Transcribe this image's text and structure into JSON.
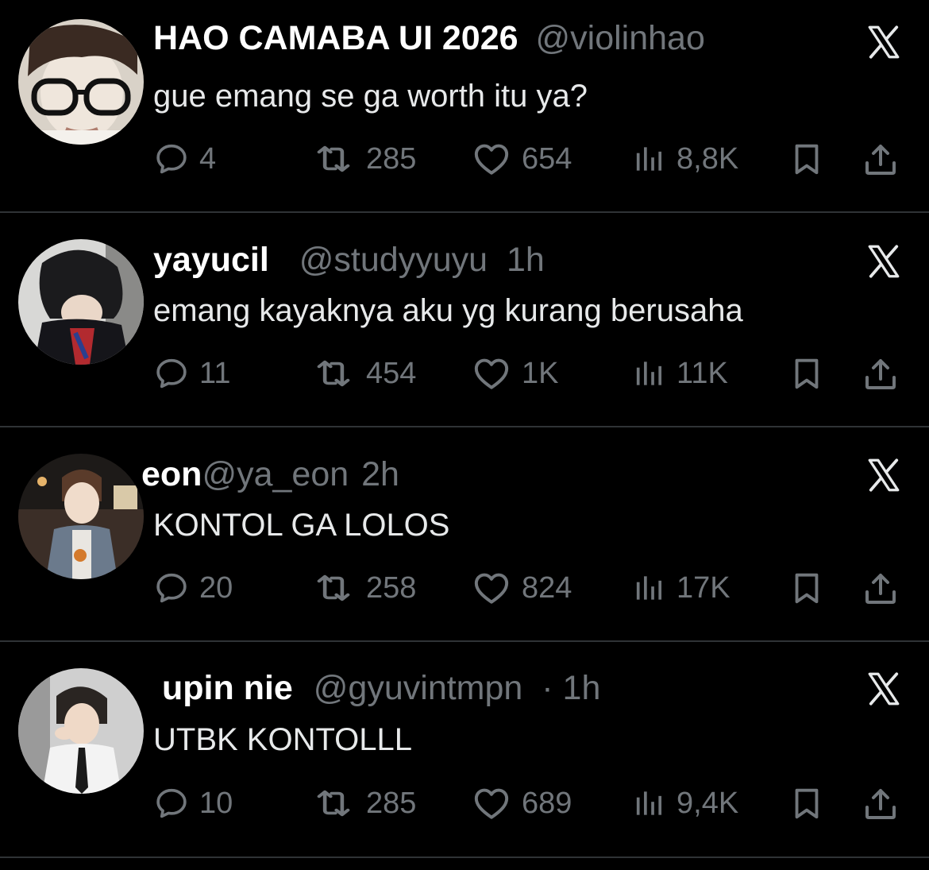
{
  "tweets": [
    {
      "name": "HAO CAMABA UI 2026",
      "handle": "@violinhao",
      "time": "",
      "text": "gue emang se ga worth itu ya?",
      "replies": "4",
      "reposts": "285",
      "likes": "654",
      "views": "8,8K"
    },
    {
      "name": "yayucil",
      "handle": "@studyyuyu",
      "time": "1h",
      "text": "emang kayaknya aku yg kurang berusaha",
      "replies": "11",
      "reposts": "454",
      "likes": "1K",
      "views": "11K"
    },
    {
      "name": "eon",
      "handle": "@ya_eon",
      "time": "2h",
      "text": "KONTOL GA LOLOS",
      "replies": "20",
      "reposts": "258",
      "likes": "824",
      "views": "17K"
    },
    {
      "name": "upin nie",
      "handle": "@gyuvintmpn",
      "time": "· 1h",
      "text": "UTBK KONTOLLL",
      "replies": "10",
      "reposts": "285",
      "likes": "689",
      "views": "9,4K"
    }
  ],
  "icons": {
    "reply": "reply-icon",
    "repost": "repost-icon",
    "like": "heart-icon",
    "views": "views-icon",
    "bookmark": "bookmark-icon",
    "share": "share-icon",
    "brand": "x-logo-icon"
  },
  "colors": {
    "background": "#000000",
    "text": "#e7e9ea",
    "muted": "#71767b",
    "divider": "#2f3336"
  }
}
